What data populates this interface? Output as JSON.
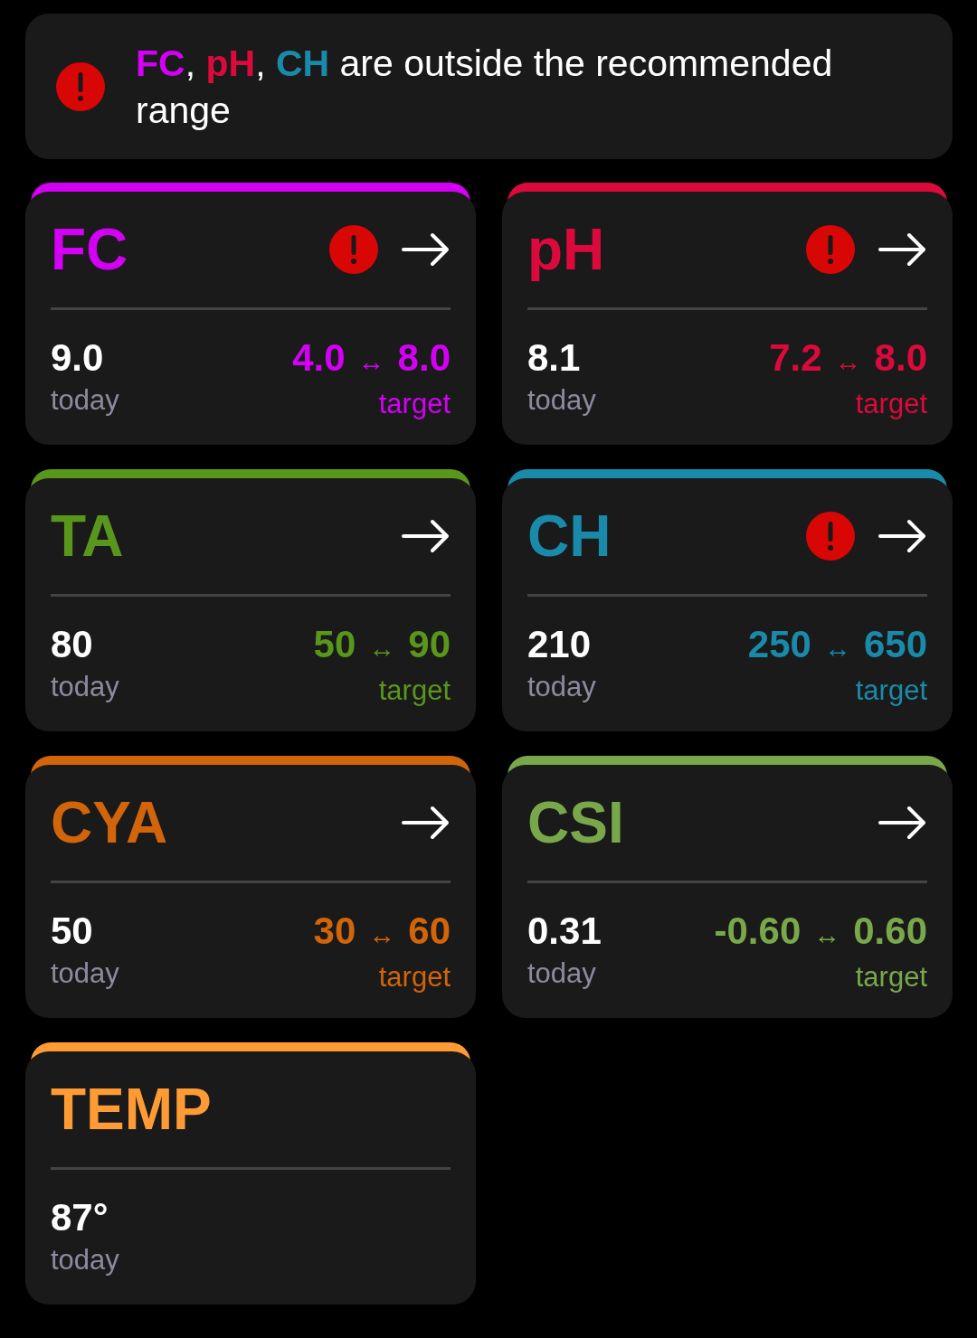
{
  "alert": {
    "items": [
      {
        "label": "FC",
        "color": "#d400f5"
      },
      {
        "label": "pH",
        "color": "#dc0a3c"
      },
      {
        "label": "CH",
        "color": "#1a8aaa"
      }
    ],
    "separator": ",",
    "message": "are outside the recommended range"
  },
  "cards": [
    {
      "name": "FC",
      "color": "#d400f5",
      "alert": true,
      "value": "9.0",
      "value_label": "today",
      "low": "4.0",
      "range_sign": "↔",
      "high": "8.0",
      "range_label": "target"
    },
    {
      "name": "pH",
      "color": "#dc0a3c",
      "alert": true,
      "value": "8.1",
      "value_label": "today",
      "low": "7.2",
      "range_sign": "↔",
      "high": "8.0",
      "range_label": "target"
    },
    {
      "name": "TA",
      "color": "#58961c",
      "alert": false,
      "value": "80",
      "value_label": "today",
      "low": "50",
      "range_sign": "↔",
      "high": "90",
      "range_label": "target"
    },
    {
      "name": "CH",
      "color": "#1a8aaa",
      "alert": true,
      "value": "210",
      "value_label": "today",
      "low": "250",
      "range_sign": "↔",
      "high": "650",
      "range_label": "target"
    },
    {
      "name": "CYA",
      "color": "#d2640a",
      "alert": false,
      "value": "50",
      "value_label": "today",
      "low": "30",
      "range_sign": "↔",
      "high": "60",
      "range_label": "target"
    },
    {
      "name": "CSI",
      "color": "#78a84a",
      "alert": false,
      "value": "0.31",
      "value_label": "today",
      "low": "-0.60",
      "range_sign": "↔",
      "high": "0.60",
      "range_label": "target"
    },
    {
      "name": "TEMP",
      "color": "#ff9b35",
      "alert": false,
      "value": "87°",
      "value_label": "today"
    }
  ]
}
